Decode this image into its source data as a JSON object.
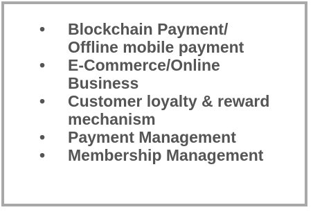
{
  "bullet_symbol": "•",
  "text_color": "#555555",
  "border_color": "#a8a8a8",
  "items": [
    {
      "line1": "Blockchain Payment/",
      "line2": "Offline mobile payment"
    },
    {
      "line1": "E-Commerce/Online",
      "line2": "Business"
    },
    {
      "line1": "Customer loyalty & reward",
      "line2": "mechanism"
    },
    {
      "line1": "Payment Management",
      "line2": ""
    },
    {
      "line1": "Membership Management",
      "line2": ""
    }
  ]
}
